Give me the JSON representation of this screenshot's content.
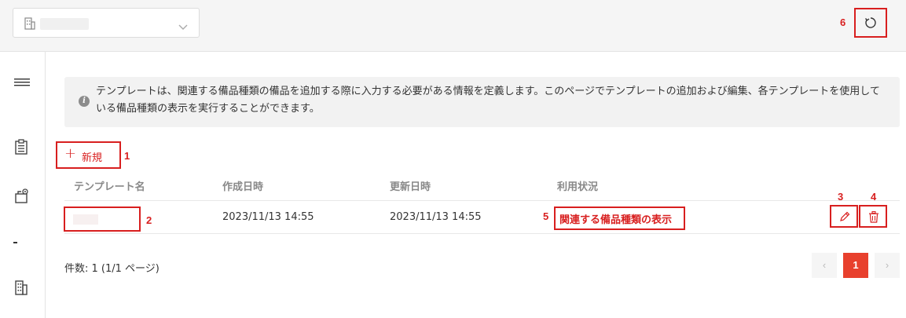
{
  "header": {
    "building_select": {
      "value": "█████",
      "icon": "building-icon"
    },
    "refresh_icon": "refresh-icon"
  },
  "sidebar": {
    "items": [
      {
        "icon": "menu-icon"
      },
      {
        "icon": "clipboard-icon"
      },
      {
        "icon": "equipment-settings-icon"
      },
      {
        "icon": "dash-icon"
      },
      {
        "icon": "building-icon"
      }
    ]
  },
  "info": {
    "text": "テンプレートは、関連する備品種類の備品を追加する際に入力する必要がある情報を定義します。このページでテンプレートの追加および編集、各テンプレートを使用している備品種類の表示を実行することができます。"
  },
  "toolbar": {
    "new_plus": "+",
    "new_label": "新規"
  },
  "table": {
    "headers": [
      "テンプレート名",
      "作成日時",
      "更新日時",
      "利用状況"
    ],
    "rows": [
      {
        "name": "████",
        "created": "2023/11/13 14:55",
        "updated": "2023/11/13 14:55",
        "usage_link": "関連する備品種類の表示"
      }
    ]
  },
  "pagination": {
    "count_text": "件数: 1 (1/1 ページ)",
    "prev": "‹",
    "current": "1",
    "next": "›"
  },
  "callouts": [
    "1",
    "2",
    "3",
    "4",
    "5",
    "6"
  ],
  "colors": {
    "accent": "#d81f1f",
    "page_active": "#e8402d",
    "info_bg": "#f2f2f2"
  }
}
